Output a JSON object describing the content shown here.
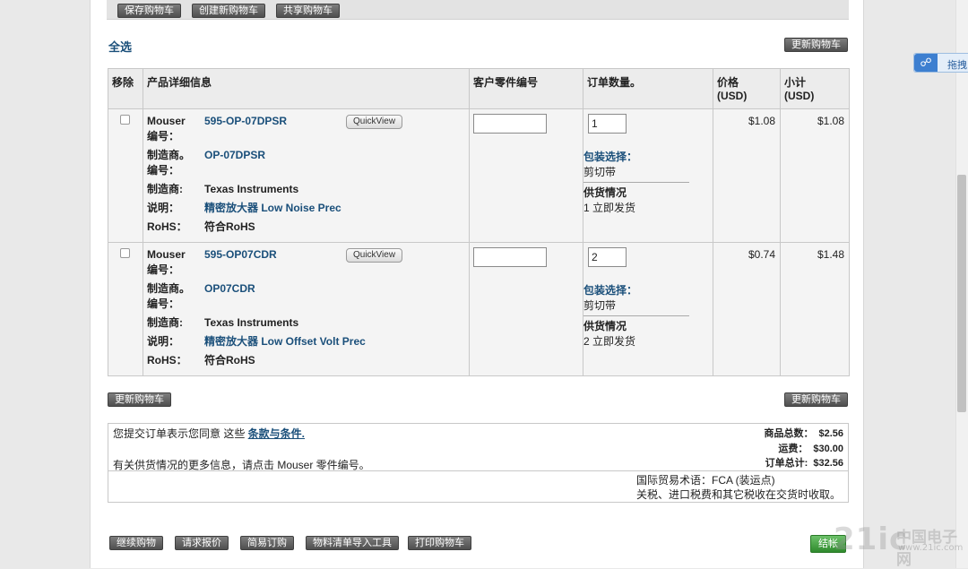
{
  "top_toolbar": {
    "save_cart": "保存购物车",
    "create_cart": "创建新购物车",
    "share_cart": "共享购物车"
  },
  "select_all": "全选",
  "update_cart": "更新购物车",
  "table": {
    "headers": {
      "remove": "移除",
      "product_details": "产品详细信息",
      "customer_part_no": "客户零件编号",
      "quantity": "订单数量。",
      "price": "价格",
      "price_unit": "(USD)",
      "subtotal": "小计",
      "subtotal_unit": "(USD)"
    },
    "labels": {
      "mouser_no": "Mouser",
      "mouser_no2": "编号：",
      "mfr_no": "制造商。",
      "mfr_no2": "编号：",
      "manufacturer": "制造商:",
      "description": "说明：",
      "rohs": "RoHS："
    },
    "quickview": "QuickView",
    "packaging_label": "包装选择：",
    "availability_label": "供货情况",
    "rows": [
      {
        "mouser_part": "595-OP-07DPSR",
        "mfr_part": "OP-07DPSR",
        "manufacturer": "Texas Instruments",
        "description": "精密放大器 Low Noise Prec",
        "rohs": "符合RoHS",
        "customer_part": "",
        "quantity": "1",
        "packaging": "剪切带",
        "availability": "1 立即发货",
        "price": "$1.08",
        "subtotal": "$1.08"
      },
      {
        "mouser_part": "595-OP07CDR",
        "mfr_part": "OP07CDR",
        "manufacturer": "Texas Instruments",
        "description": "精密放大器 Low Offset Volt Prec",
        "rohs": "符合RoHS",
        "customer_part": "",
        "quantity": "2",
        "packaging": "剪切带",
        "availability": "2 立即发货",
        "price": "$0.74",
        "subtotal": "$1.48"
      }
    ]
  },
  "summary": {
    "terms_prefix": "您提交订单表示您同意 这些 ",
    "terms_link": "条款与条件.",
    "more_info": "有关供货情况的更多信息，请点击 Mouser 零件编号。",
    "merch_total_label": "商品总数：",
    "merch_total": "$2.56",
    "shipping_label": "运费：",
    "shipping": "$30.00",
    "order_total_label": "订单总计:",
    "order_total": "$32.56",
    "incoterms": "国际贸易术语：FCA (装运点)",
    "duties_note": "关税、进口税费和其它税收在交货时收取。"
  },
  "bottom_toolbar": {
    "continue_shopping": "继续购物",
    "request_quote": "请求报价",
    "easy_order": "简易订购",
    "bom_import": "物料清单导入工具",
    "print_cart": "打印购物车",
    "checkout": "结帐"
  },
  "share_widget": {
    "label": "拖拽"
  },
  "watermark": {
    "logo": "21ic",
    "cn": "中国电子网",
    "url": "www.21ic.com"
  }
}
